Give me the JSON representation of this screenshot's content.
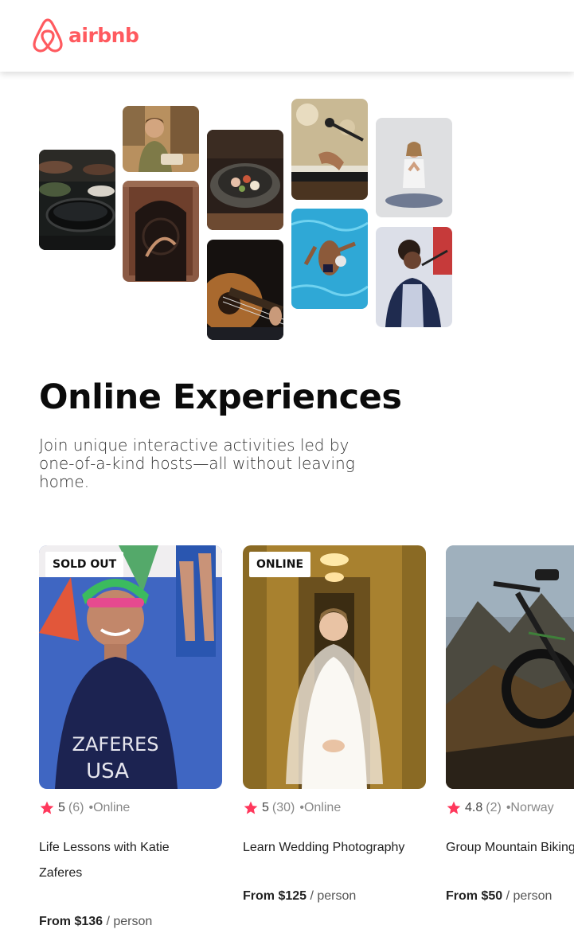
{
  "brand": {
    "name": "airbnb",
    "color": "#ff5a5f"
  },
  "hero": {
    "title": "Online Experiences",
    "subtitle": "Join unique interactive activities led by one-of-a-kind hosts—all without leaving home."
  },
  "photos": [
    {
      "subject": "cooking-pan"
    },
    {
      "subject": "baker-woman"
    },
    {
      "subject": "dancer-doorway"
    },
    {
      "subject": "food-bowl"
    },
    {
      "subject": "guitar"
    },
    {
      "subject": "microphone-keyboard"
    },
    {
      "subject": "swimmer-pool"
    },
    {
      "subject": "yoga-meditation"
    },
    {
      "subject": "singer-microphone"
    }
  ],
  "experiences": [
    {
      "badge": "SOLD OUT",
      "rating": "5",
      "reviews": "(6)",
      "location": "•Online",
      "title": "Life Lessons with Katie Zaferes",
      "price": "From $136",
      "unit": " / person",
      "shirt_text_1": "ZAFERES",
      "shirt_text_2": "USA"
    },
    {
      "badge": "ONLINE",
      "rating": "5",
      "reviews": "(30)",
      "location": "•Online",
      "title": "Learn Wedding Photography",
      "price": "From $125",
      "unit": " / person"
    },
    {
      "badge": "",
      "rating": "4.8",
      "reviews": "(2)",
      "location": "•Norway",
      "title": "Group Mountain Biking",
      "price": "From $50",
      "unit": " / person"
    }
  ],
  "colors": {
    "star": "#ff385c",
    "accent": "#ff5a5f"
  }
}
